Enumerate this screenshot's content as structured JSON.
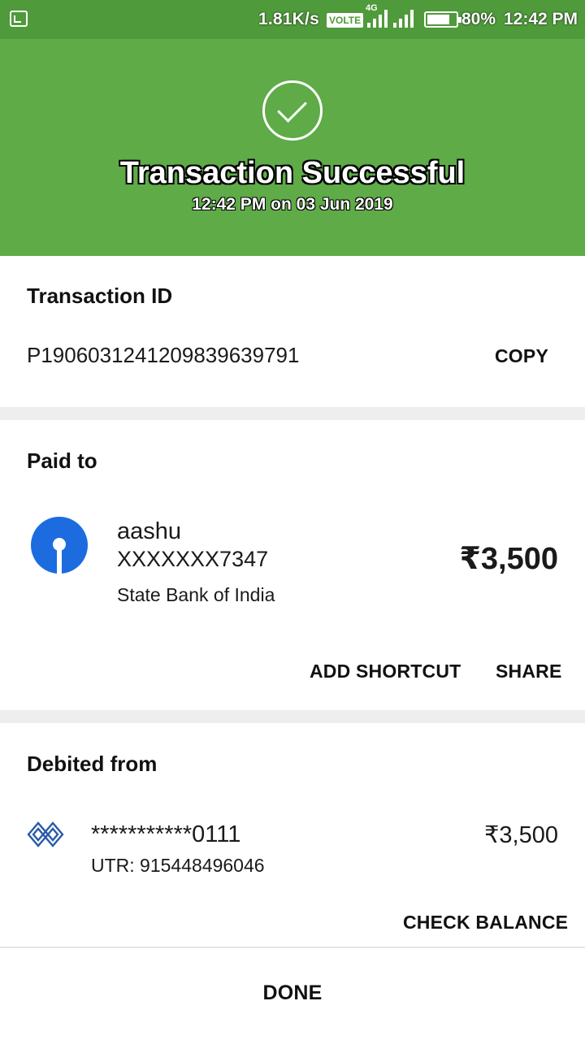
{
  "status_bar": {
    "speed": "1.81K/s",
    "volte": "VOLTE",
    "network": "4G",
    "battery": "80%",
    "battery_level": 0.8,
    "time": "12:42 PM"
  },
  "header": {
    "title": "Transaction Successful",
    "subtitle": "12:42 PM on 03 Jun 2019",
    "bg_color": "#5eab48",
    "icon": "check-circle-icon"
  },
  "transaction": {
    "label": "Transaction ID",
    "id": "P1906031241209839639791",
    "copy_label": "COPY"
  },
  "paid_to": {
    "label": "Paid to",
    "name": "aashu",
    "account": "XXXXXXX7347",
    "bank": "State Bank of India",
    "amount": "₹3,500",
    "logo_icon": "sbi-logo-icon",
    "add_shortcut_label": "ADD SHORTCUT",
    "share_label": "SHARE"
  },
  "debited_from": {
    "label": "Debited from",
    "account": "***********0111",
    "utr": "UTR: 915448496046",
    "amount": "₹3,500",
    "logo_icon": "bank-logo-icon",
    "check_balance_label": "CHECK BALANCE"
  },
  "footer": {
    "done_label": "DONE"
  }
}
